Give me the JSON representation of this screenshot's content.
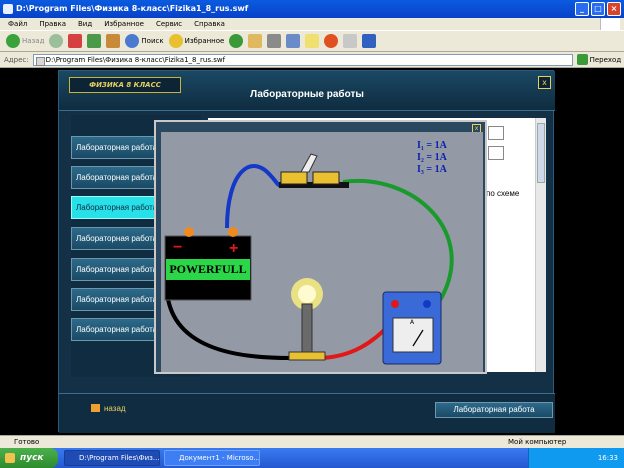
{
  "window": {
    "title": "D:\\Program Files\\Физика 8-класс\\Fizika1_8_rus.swf"
  },
  "menu": [
    "Файл",
    "Правка",
    "Вид",
    "Избранное",
    "Сервис",
    "Справка"
  ],
  "toolbar": {
    "back": "Назад",
    "search": "Поиск",
    "favorites": "Избранное"
  },
  "address": {
    "label": "Адрес:",
    "value": "D:\\Program Files\\Физика 8-класс\\Fizika1_8_rus.swf",
    "go": "Переход"
  },
  "app": {
    "logo": "ФИЗИКА 8 КЛАСС",
    "title": "Лабораторные работы",
    "close": "x",
    "nav": [
      "Лабораторная работа",
      "Лабораторная работа",
      "Лабораторная работа",
      "Лабораторная работа",
      "Лабораторная работа",
      "Лабораторная работа",
      "Лабораторная работа"
    ],
    "sheet_text": "по схеме",
    "back": "назад",
    "lab_button": "Лабораторная работа"
  },
  "popup": {
    "close": "x",
    "readings": [
      "I₁ = 1A",
      "I₂ = 1A",
      "I₃ = 1A"
    ],
    "battery": "POWERFULL",
    "ammeter_letter": "A"
  },
  "status": {
    "left": "Готово",
    "right": "Мой компьютер"
  },
  "taskbar": {
    "start": "пуск",
    "tasks": [
      "D:\\Program Files\\Физ...",
      "Документ1 - Microso..."
    ],
    "clock": "16:33"
  },
  "colors": {
    "wire_green": "#1a9a2c",
    "wire_blue": "#1438c8",
    "wire_red": "#e01818",
    "wire_black": "#000000"
  }
}
